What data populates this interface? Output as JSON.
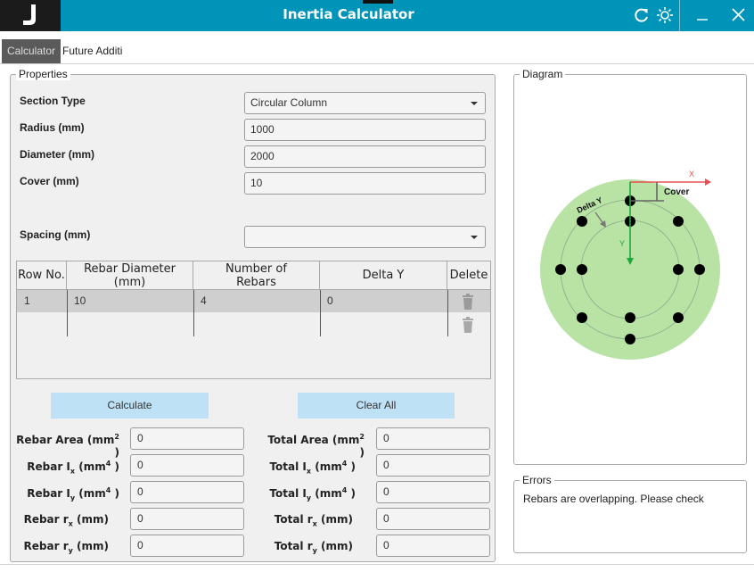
{
  "app": {
    "title": "Inertia Calculator"
  },
  "tabs": [
    {
      "label": "Calculator"
    },
    {
      "label": "Future Additi"
    }
  ],
  "properties": {
    "title": "Properties",
    "section_type": {
      "label": "Section Type",
      "value": "Circular Column"
    },
    "radius": {
      "label": "Radius (mm)",
      "value": "1000"
    },
    "diameter": {
      "label": "Diameter (mm)",
      "value": "2000"
    },
    "cover": {
      "label": "Cover (mm)",
      "value": "10"
    },
    "spacing": {
      "label": "Spacing (mm)",
      "value": ""
    }
  },
  "rebar_table": {
    "headers": [
      "Row No.",
      "Rebar Diameter (mm)",
      "Number of Rebars",
      "Delta Y",
      "Delete"
    ],
    "header_lines": [
      [
        "Row No."
      ],
      [
        "Rebar Diameter",
        "(mm)"
      ],
      [
        "Number of",
        "Rebars"
      ],
      [
        "Delta Y"
      ],
      [
        "Delete"
      ]
    ],
    "rows": [
      {
        "row_no": "1",
        "rebar_diameter": "10",
        "number_of_rebars": "4",
        "delta_y": "0"
      }
    ]
  },
  "buttons": {
    "calculate": "Calculate",
    "clear_all": "Clear All"
  },
  "results": {
    "rebar_area": {
      "label": "Rebar Area (mm",
      "sup": "2",
      "suffix": " )",
      "value": "0"
    },
    "rebar_ix": {
      "label": "Rebar I",
      "sub": "x",
      "mid": " (mm",
      "sup": "4",
      "suffix": " )",
      "value": "0"
    },
    "rebar_iy": {
      "label": "Rebar I",
      "sub": "y",
      "mid": " (mm",
      "sup": "4",
      "suffix": " )",
      "value": "0"
    },
    "rebar_rx": {
      "label": "Rebar r",
      "sub": "x",
      "suffix": " (mm)",
      "value": "0"
    },
    "rebar_ry": {
      "label": "Rebar r",
      "sub": "y",
      "suffix": " (mm)",
      "value": "0"
    },
    "total_area": {
      "label": "Total Area (mm",
      "sup": "2",
      "suffix": " )",
      "value": "0"
    },
    "total_ix": {
      "label": "Total I",
      "sub": "x",
      "mid": " (mm",
      "sup": "4",
      "suffix": " )",
      "value": "0"
    },
    "total_iy": {
      "label": "Total I",
      "sub": "y",
      "mid": " (mm",
      "sup": "4",
      "suffix": " )",
      "value": "0"
    },
    "total_rx": {
      "label": "Total r",
      "sub": "x",
      "suffix": " (mm)",
      "value": "0"
    },
    "total_ry": {
      "label": "Total r",
      "sub": "y",
      "suffix": " (mm)",
      "value": "0"
    }
  },
  "diagram": {
    "title": "Diagram",
    "labels": {
      "x_axis": "X",
      "y_axis": "Y",
      "cover": "Cover",
      "delta_y": "Delta Y"
    },
    "colors": {
      "section_fill": "#b9e2a5",
      "x_axis": "#e85050",
      "y_axis": "#1ea83c",
      "rebar": "#000000"
    }
  },
  "errors": {
    "title": "Errors",
    "message": "Rebars are overlapping. Please check"
  },
  "icons": {
    "refresh": "refresh-icon",
    "theme": "sun-icon",
    "minimize": "minimize-icon",
    "close": "close-icon",
    "delete": "trash-icon"
  }
}
